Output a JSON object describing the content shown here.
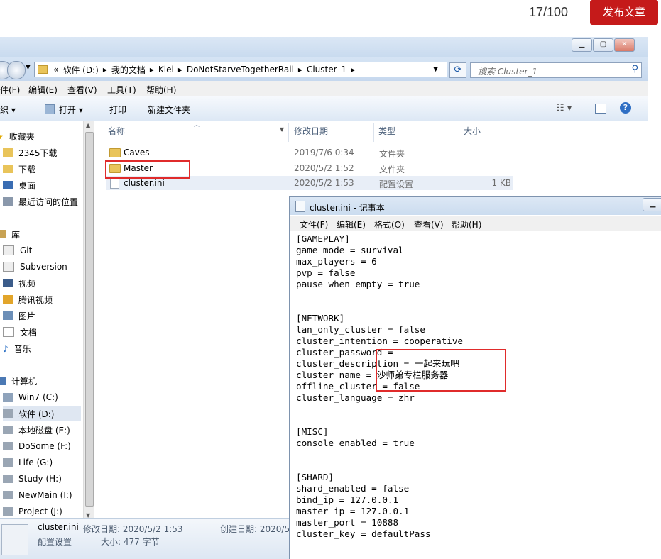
{
  "web": {
    "counter": "17/100",
    "publish_button": "发布文章"
  },
  "explorer": {
    "breadcrumb": [
      "«",
      "软件 (D:)",
      "我的文档",
      "Klei",
      "DoNotStarveTogetherRail",
      "Cluster_1"
    ],
    "search_placeholder": "搜索 Cluster_1",
    "menu": [
      "件(F)",
      "编辑(E)",
      "查看(V)",
      "工具(T)",
      "帮助(H)"
    ],
    "toolbar": {
      "organize": "组织 ▾",
      "open": "打开 ▾",
      "print": "打印",
      "new_folder": "新建文件夹"
    },
    "nav": {
      "favorites": "收藏夹",
      "fav_items": [
        "2345下载",
        "下载",
        "桌面",
        "最近访问的位置"
      ],
      "library": "库",
      "lib_items": [
        "Git",
        "Subversion",
        "视频",
        "腾讯视频",
        "图片",
        "文档",
        "音乐"
      ],
      "computer": "计算机",
      "drives": [
        "Win7 (C:)",
        "软件 (D:)",
        "本地磁盘 (E:)",
        "DoSome (F:)",
        "Life (G:)",
        "Study (H:)",
        "NewMain (I:)",
        "Project (J:)"
      ]
    },
    "columns": [
      "名称",
      "修改日期",
      "类型",
      "大小"
    ],
    "files": [
      {
        "name": "Caves",
        "date": "2019/7/6 0:34",
        "type": "文件夹",
        "size": ""
      },
      {
        "name": "Master",
        "date": "2020/5/2 1:52",
        "type": "文件夹",
        "size": ""
      },
      {
        "name": "cluster.ini",
        "date": "2020/5/2 1:53",
        "type": "配置设置",
        "size": "1 KB"
      }
    ],
    "details": {
      "filename": "cluster.ini",
      "modified": "修改日期: 2020/5/2 1:53",
      "created": "创建日期: 2020/5",
      "type": "配置设置",
      "size": "大小: 477 字节"
    }
  },
  "notepad": {
    "title": "cluster.ini - 记事本",
    "menu": [
      "文件(F)",
      "编辑(E)",
      "格式(O)",
      "查看(V)",
      "帮助(H)"
    ],
    "lines": [
      "[GAMEPLAY]",
      "game_mode = survival",
      "max_players = 6",
      "pvp = false",
      "pause_when_empty = true",
      "",
      "",
      "[NETWORK]",
      "lan_only_cluster = false",
      "cluster_intention = cooperative",
      "cluster_password =",
      "cluster_description = 一起来玩吧",
      "cluster_name = 沙师弟专栏服务器",
      "offline_cluster = false",
      "cluster_language = zhr",
      "",
      "",
      "[MISC]",
      "console_enabled = true",
      "",
      "",
      "[SHARD]",
      "shard_enabled = false",
      "bind_ip = 127.0.0.1",
      "master_ip = 127.0.0.1",
      "master_port = 10888",
      "cluster_key = defaultPass"
    ]
  }
}
